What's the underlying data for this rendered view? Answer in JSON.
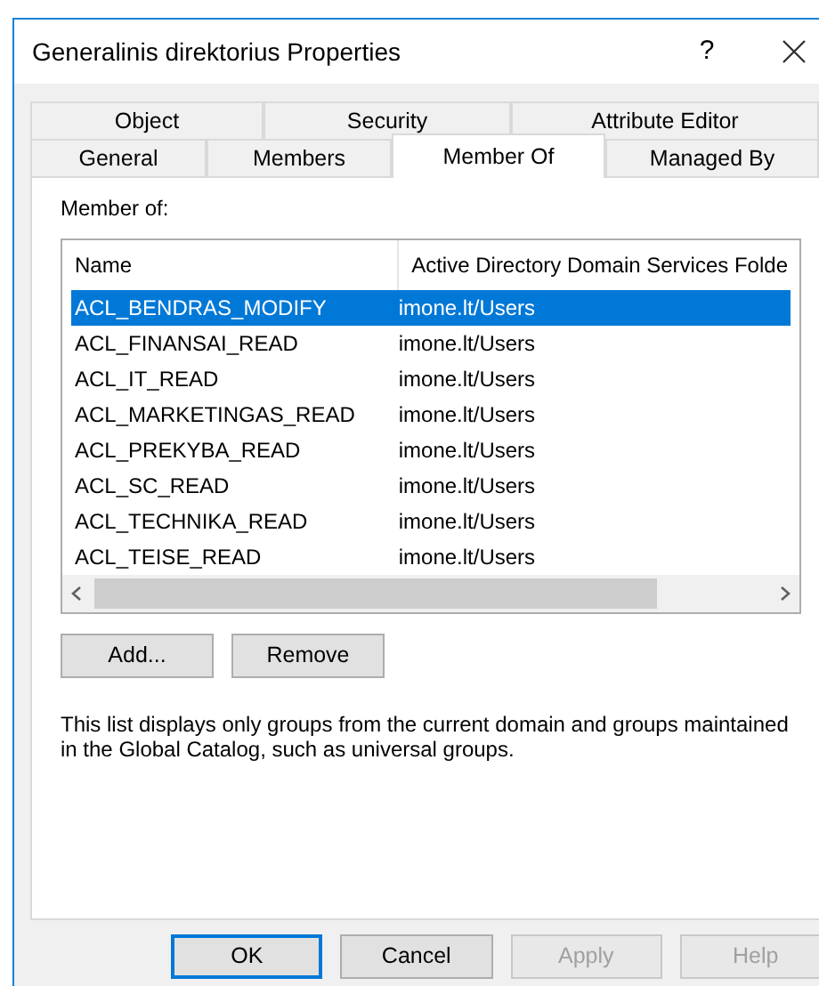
{
  "window": {
    "title": "Generalinis direktorius Properties",
    "help_button": "?"
  },
  "tabs": [
    [
      {
        "label": "Object",
        "selected": false
      },
      {
        "label": "Security",
        "selected": false
      },
      {
        "label": "Attribute Editor",
        "selected": false
      }
    ],
    [
      {
        "label": "General",
        "selected": false
      },
      {
        "label": "Members",
        "selected": false
      },
      {
        "label": "Member Of",
        "selected": true
      },
      {
        "label": "Managed By",
        "selected": false
      }
    ]
  ],
  "group_label": "Member of:",
  "list": {
    "columns": [
      "Name",
      "Active Directory Domain Services Folde"
    ],
    "rows": [
      {
        "cells": [
          "ACL_BENDRAS_MODIFY",
          "imone.lt/Users"
        ],
        "selected": true
      },
      {
        "cells": [
          "ACL_FINANSAI_READ",
          "imone.lt/Users"
        ],
        "selected": false
      },
      {
        "cells": [
          "ACL_IT_READ",
          "imone.lt/Users"
        ],
        "selected": false
      },
      {
        "cells": [
          "ACL_MARKETINGAS_READ",
          "imone.lt/Users"
        ],
        "selected": false
      },
      {
        "cells": [
          "ACL_PREKYBA_READ",
          "imone.lt/Users"
        ],
        "selected": false
      },
      {
        "cells": [
          "ACL_SC_READ",
          "imone.lt/Users"
        ],
        "selected": false
      },
      {
        "cells": [
          "ACL_TECHNIKA_READ",
          "imone.lt/Users"
        ],
        "selected": false
      },
      {
        "cells": [
          "ACL_TEISE_READ",
          "imone.lt/Users"
        ],
        "selected": false
      }
    ]
  },
  "list_buttons": [
    "Add...",
    "Remove"
  ],
  "note": "This list displays only groups from the current domain and groups maintained in the Global Catalog, such as universal groups.",
  "footer_buttons": [
    {
      "label": "OK",
      "default": true,
      "disabled": false
    },
    {
      "label": "Cancel",
      "default": false,
      "disabled": false
    },
    {
      "label": "Apply",
      "default": false,
      "disabled": true
    },
    {
      "label": "Help",
      "default": false,
      "disabled": true
    }
  ]
}
